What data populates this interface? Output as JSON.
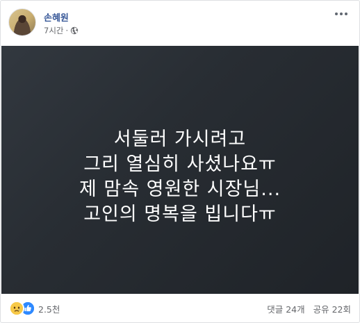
{
  "post": {
    "author_name": "손혜원",
    "time_text": "7시간",
    "separator": "·",
    "privacy_icon": "globe-icon",
    "more_icon": "more-options-icon",
    "content_lines": [
      "서둘러 가시려고",
      "그리 열심히 사셨나요ㅠ",
      "제 맘속 영원한 시장님...",
      "고인의 명복을 빕니다ㅠ"
    ],
    "background_color": "#2b3036",
    "text_color": "#ffffff"
  },
  "footer": {
    "reaction_icons": [
      "sad-icon",
      "like-icon"
    ],
    "reaction_count": "2.5천",
    "comments_text": "댓글 24개",
    "shares_text": "공유 22회"
  },
  "colors": {
    "author_link": "#385898",
    "meta_text": "#65676b",
    "like_blue": "#2e89ff",
    "sad_yellow": "#f7c948"
  }
}
